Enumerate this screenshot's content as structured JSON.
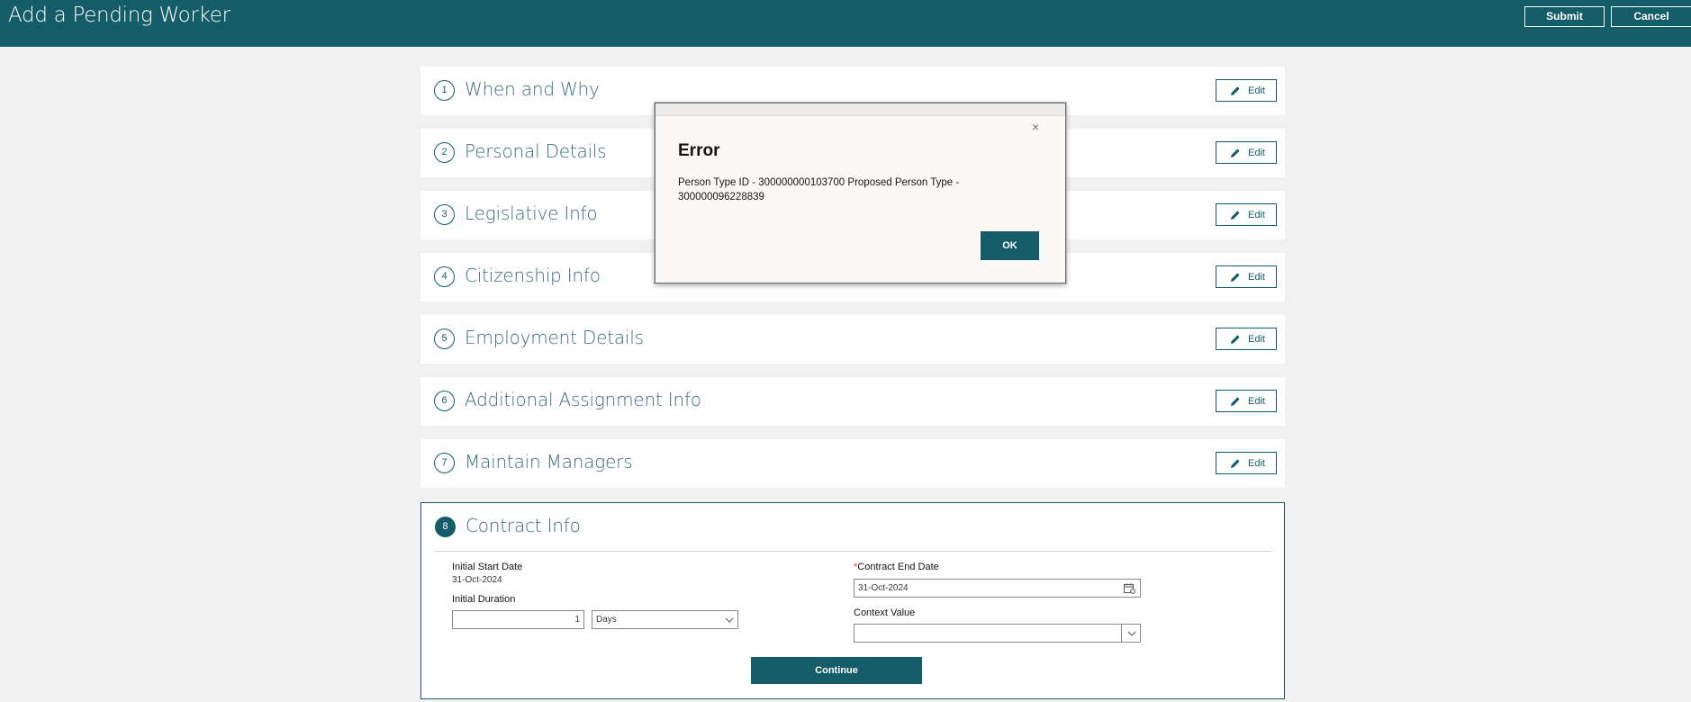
{
  "header": {
    "title": "Add a Pending Worker",
    "submit_label": "Submit",
    "cancel_label": "Cancel"
  },
  "sections": [
    {
      "number": "1",
      "title": "When and Why",
      "edit_label": "Edit"
    },
    {
      "number": "2",
      "title": "Personal Details",
      "edit_label": "Edit"
    },
    {
      "number": "3",
      "title": "Legislative Info",
      "edit_label": "Edit"
    },
    {
      "number": "4",
      "title": "Citizenship Info",
      "edit_label": "Edit"
    },
    {
      "number": "5",
      "title": "Employment Details",
      "edit_label": "Edit"
    },
    {
      "number": "6",
      "title": "Additional Assignment Info",
      "edit_label": "Edit"
    },
    {
      "number": "7",
      "title": "Maintain Managers",
      "edit_label": "Edit"
    }
  ],
  "contract": {
    "number": "8",
    "title": "Contract Info",
    "initial_start_date_label": "Initial Start Date",
    "initial_start_date_value": "31-Oct-2024",
    "initial_duration_label": "Initial Duration",
    "initial_duration_value": "1",
    "duration_unit_value": "Days",
    "contract_end_date_required": "*",
    "contract_end_date_label": "Contract End Date",
    "contract_end_date_value": "31-Oct-2024",
    "context_value_label": "Context Value",
    "context_value_value": "",
    "continue_label": "Continue"
  },
  "dialog": {
    "close_symbol": "×",
    "title": "Error",
    "message": "Person Type ID - 300000000103700 Proposed Person Type - 300000096228839",
    "ok_label": "OK"
  },
  "colors": {
    "brand": "#145c67",
    "background": "#f1f1f1",
    "required": "#c74634"
  },
  "icons": {
    "edit": "pencil-icon",
    "calendar": "calendar-icon",
    "dropdown": "chevron-down-icon",
    "close": "close-icon"
  }
}
